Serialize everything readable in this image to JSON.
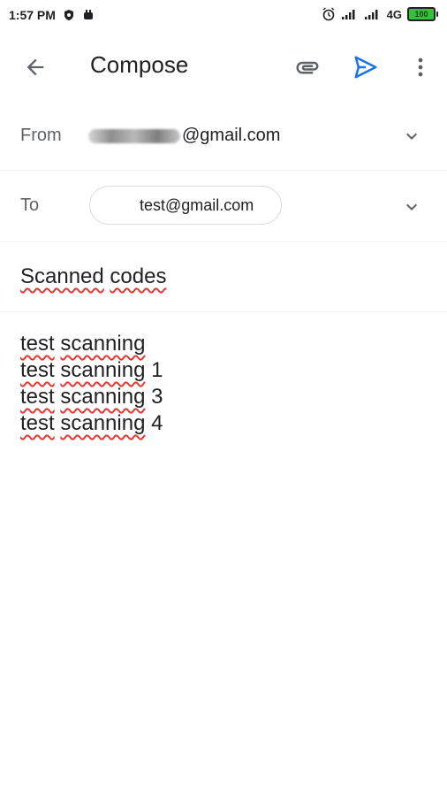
{
  "status_bar": {
    "time": "1:57 PM",
    "network": "4G",
    "battery": "100",
    "icons": [
      "vpn-shield-icon",
      "notification-app-icon",
      "alarm-icon",
      "signal-icon",
      "signal-icon",
      "battery-icon"
    ],
    "battery_color": "#35c23a"
  },
  "app_bar": {
    "title": "Compose",
    "icons": [
      "back-arrow-icon",
      "paperclip-icon",
      "send-icon",
      "more-vert-icon"
    ],
    "accent": "#1a73e8"
  },
  "from": {
    "label": "From",
    "value": "@gmail.com"
  },
  "to": {
    "label": "To",
    "recipient": "test@gmail.com"
  },
  "subject": {
    "word1": "Scanned",
    "word2": "codes"
  },
  "body": {
    "lines": [
      {
        "w1": "test",
        "w2": "scanning",
        "n": ""
      },
      {
        "w1": "test",
        "w2": "scanning",
        "n": "1"
      },
      {
        "w1": "test",
        "w2": "scanning",
        "n": "3"
      },
      {
        "w1": "test",
        "w2": "scanning",
        "n": "4"
      }
    ]
  },
  "colors": {
    "spellcheck": "#e53935",
    "divider": "#eceff1"
  }
}
